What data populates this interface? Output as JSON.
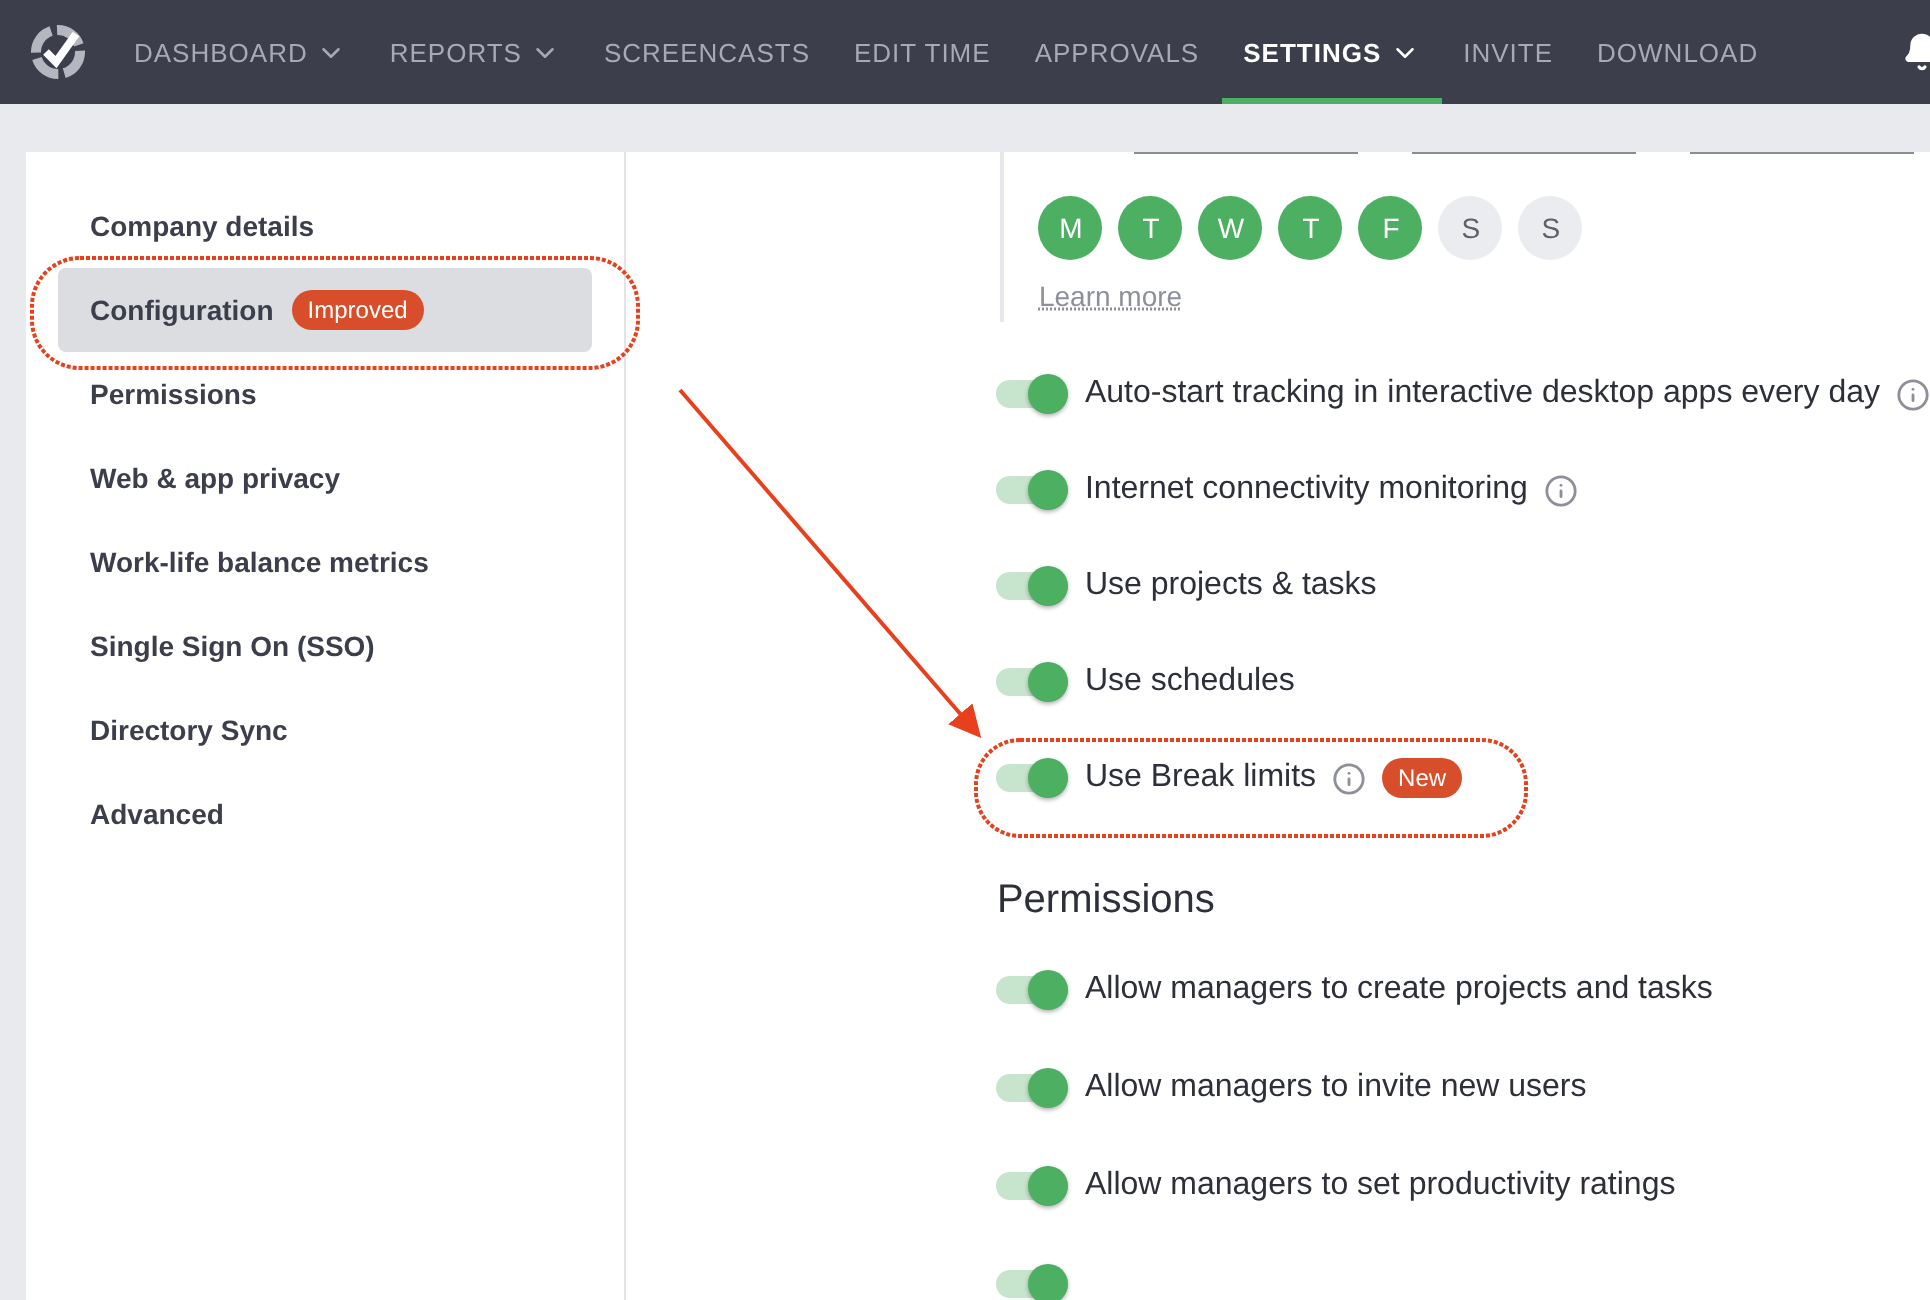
{
  "nav": {
    "items": [
      {
        "label": "DASHBOARD",
        "dropdown": true,
        "selected": false
      },
      {
        "label": "REPORTS",
        "dropdown": true,
        "selected": false
      },
      {
        "label": "SCREENCASTS",
        "dropdown": false,
        "selected": false
      },
      {
        "label": "EDIT TIME",
        "dropdown": false,
        "selected": false
      },
      {
        "label": "APPROVALS",
        "dropdown": false,
        "selected": false
      },
      {
        "label": "SETTINGS",
        "dropdown": true,
        "selected": true
      },
      {
        "label": "INVITE",
        "dropdown": false,
        "selected": false
      },
      {
        "label": "DOWNLOAD",
        "dropdown": false,
        "selected": false
      }
    ]
  },
  "sidebar": {
    "items": [
      {
        "label": "Company details",
        "selected": false
      },
      {
        "label": "Configuration",
        "selected": true,
        "badge": "Improved"
      },
      {
        "label": "Permissions",
        "selected": false
      },
      {
        "label": "Web & app privacy",
        "selected": false
      },
      {
        "label": "Work-life balance metrics",
        "selected": false
      },
      {
        "label": "Single Sign On (SSO)",
        "selected": false
      },
      {
        "label": "Directory Sync",
        "selected": false
      },
      {
        "label": "Advanced",
        "selected": false
      }
    ]
  },
  "workdays": {
    "days": [
      {
        "label": "M",
        "selected": true
      },
      {
        "label": "T",
        "selected": true
      },
      {
        "label": "W",
        "selected": true
      },
      {
        "label": "T",
        "selected": true
      },
      {
        "label": "F",
        "selected": true
      },
      {
        "label": "S",
        "selected": false
      },
      {
        "label": "S",
        "selected": false
      }
    ],
    "link": "Learn more"
  },
  "settings": [
    {
      "label": "Auto-start tracking in interactive desktop apps every day",
      "on": true,
      "info": true
    },
    {
      "label": "Internet connectivity monitoring",
      "on": true,
      "info": true
    },
    {
      "label": "Use projects & tasks",
      "on": true,
      "info": false
    },
    {
      "label": "Use schedules",
      "on": true,
      "info": false
    },
    {
      "label": "Use Break limits",
      "on": true,
      "info": true,
      "badge": "New"
    }
  ],
  "permissions": {
    "title": "Permissions",
    "items": [
      {
        "label": "Allow managers to create projects and tasks",
        "on": true
      },
      {
        "label": "Allow managers to invite new users",
        "on": true
      },
      {
        "label": "Allow managers to set productivity ratings",
        "on": true
      },
      {
        "on": true
      }
    ]
  }
}
